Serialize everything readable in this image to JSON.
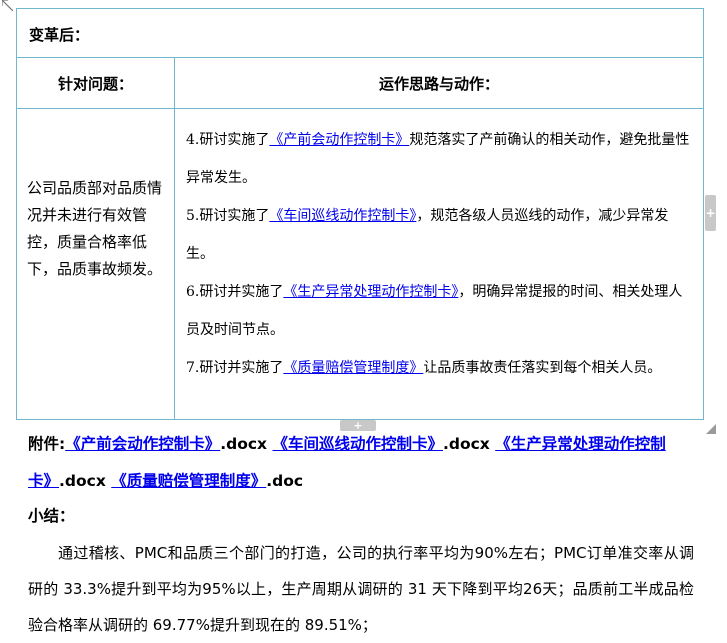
{
  "table": {
    "title": "变革后：",
    "header_left": "针对问题：",
    "header_right": "运作思路与动作：",
    "problem": "公司品质部对品质情况并未进行有效管控，质量合格率低下，品质事故频发。",
    "actions": [
      {
        "prefix": "4.研讨实施了",
        "link": "《产前会动作控制卡》",
        "suffix": "规范落实了产前确认的相关动作，避免批量性异常发生。"
      },
      {
        "prefix": "5.研讨实施了",
        "link": "《车间巡线动作控制卡》",
        "suffix": "，规范各级人员巡线的动作，减少异常发生。"
      },
      {
        "prefix": "6.研讨并实施了",
        "link": "《生产异常处理动作控制卡》",
        "suffix": "，明确异常提报的时间、相关处理人员及时间节点。"
      },
      {
        "prefix": "7.研讨并实施了",
        "link": "《质量赔偿管理制度》",
        "suffix": "让品质事故责任落实到每个相关人员。"
      }
    ]
  },
  "attachments": {
    "label": "附件:",
    "items": [
      {
        "link": "《产前会动作控制卡》",
        "ext": ".docx"
      },
      {
        "link": "《车间巡线动作控制卡》",
        "ext": ".docx"
      },
      {
        "link": "《生产异常处理动作控制卡》",
        "ext": ".docx"
      },
      {
        "link": "《质量赔偿管理制度》",
        "ext": ".doc"
      }
    ]
  },
  "summary": {
    "title": "小结：",
    "text": "通过稽核、PMC和品质三个部门的打造，公司的执行率平均为90%左右；PMC订单准交率从调研的 33.3%提升到平均为95%以上，生产周期从调研的 31 天下降到平均26天；品质前工半成品检验合格率从调研的 69.77%提升到现在的 89.51%；"
  },
  "icons": {
    "table_move": "plus-icon",
    "row_add": "plus-icon",
    "col_add": "plus-icon",
    "resize": "resize-corner-icon"
  },
  "colors": {
    "table_border": "#6fb8cc",
    "link": "#0000ee"
  }
}
